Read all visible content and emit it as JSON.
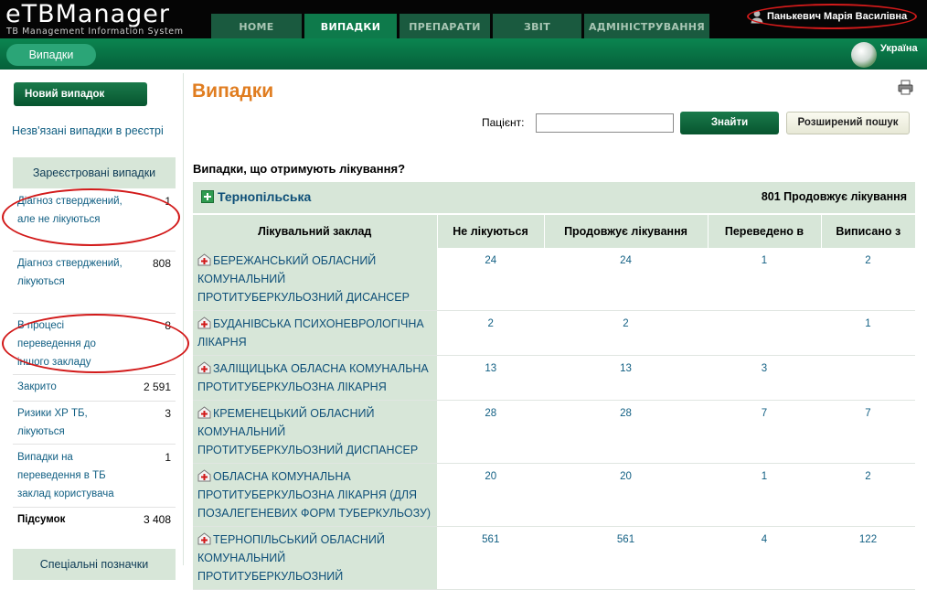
{
  "app": {
    "logo": "eTBManager",
    "subtitle": "TB Management Information System"
  },
  "nav": {
    "tabs": [
      "HOME",
      "ВИПАДКИ",
      "ПРЕПАРАТИ",
      "ЗВІТ",
      "АДМІНІСТРУВАННЯ"
    ],
    "active_tab": "ВИПАДКИ"
  },
  "user": {
    "name": "Панькевич Марія Василівна",
    "icon": "person-icon"
  },
  "subbar": {
    "section": "Випадки",
    "country": "Україна",
    "country_icon": "globe-icon"
  },
  "sidebar": {
    "new_case": "Новий випадок",
    "unlinked": "Незв'язані випадки в реєстрі",
    "registered_header": "Зареєстровані випадки",
    "items": [
      {
        "label": "Діагноз стверджений, але не лікуються",
        "count": "1"
      },
      {
        "label": "Діагноз стверджений, лікуються",
        "count": "808"
      },
      {
        "label": "В процесі переведення до іншого закладу",
        "count": "8"
      },
      {
        "label": "Закрито",
        "count": "2 591"
      },
      {
        "label": "Ризики ХР ТБ, лікуються",
        "count": "3"
      },
      {
        "label": "Випадки на переведення в ТБ заклад користувача",
        "count": "1"
      }
    ],
    "total_label": "Підсумок",
    "total_count": "3 408",
    "special_header": "Спеціальні позначки"
  },
  "main": {
    "title": "Випадки",
    "patient_label": "Пацієнт:",
    "patient_value": "",
    "find_button": "Знайти",
    "advanced_search": "Розширений пошук",
    "section_title": "Випадки, що отримують лікування?",
    "region": {
      "name": "Тернопільська",
      "status": "801 Продовжує лікування"
    },
    "columns": [
      "Лікувальний заклад",
      "Не лікуються",
      "Продовжує лікування",
      "Переведено в",
      "Виписано з"
    ],
    "rows": [
      {
        "facility": "БЕРЕЖАНСЬКИЙ ОБЛАСНИЙ КОМУНАЛЬНИЙ ПРОТИТУБЕРКУЛЬОЗНИЙ ДИСАНСЕР",
        "not_treated": "24",
        "continue": "24",
        "transferred_in": "1",
        "discharged": "2"
      },
      {
        "facility": "БУДАНІВСЬКА ПСИХОНЕВРОЛОГІЧНА ЛІКАРНЯ",
        "not_treated": "2",
        "continue": "2",
        "transferred_in": "",
        "discharged": "1"
      },
      {
        "facility": "ЗАЛІЩИЦЬКА ОБЛАСНА КОМУНАЛЬНА ПРОТИТУБЕРКУЛЬОЗНА ЛІКАРНЯ",
        "not_treated": "13",
        "continue": "13",
        "transferred_in": "3",
        "discharged": ""
      },
      {
        "facility": "КРЕМЕНЕЦЬКИЙ ОБЛАСНИЙ КОМУНАЛЬНИЙ ПРОТИТУБЕРКУЛЬОЗНИЙ ДИСПАНСЕР",
        "not_treated": "28",
        "continue": "28",
        "transferred_in": "7",
        "discharged": "7"
      },
      {
        "facility": "ОБЛАСНА КОМУНАЛЬНА ПРОТИТУБЕРКУЛЬОЗНА ЛІКАРНЯ (ДЛЯ ПОЗАЛЕГЕНЕВИХ ФОРМ ТУБЕРКУЛЬОЗУ)",
        "not_treated": "20",
        "continue": "20",
        "transferred_in": "1",
        "discharged": "2"
      },
      {
        "facility": "ТЕРНОПІЛЬСЬКИЙ ОБЛАСНИЙ КОМУНАЛЬНИЙ ПРОТИТУБЕРКУЛЬОЗНИЙ",
        "not_treated": "561",
        "continue": "561",
        "transferred_in": "4",
        "discharged": "122"
      }
    ]
  },
  "colors": {
    "header_bg": "#050505",
    "tab_active": "#0e7a4b",
    "subbar": "#0b8550",
    "title_orange": "#e07d20",
    "panel_green": "#d7e6d8",
    "link_blue": "#115f83",
    "annotation_red": "#d21a1a"
  }
}
